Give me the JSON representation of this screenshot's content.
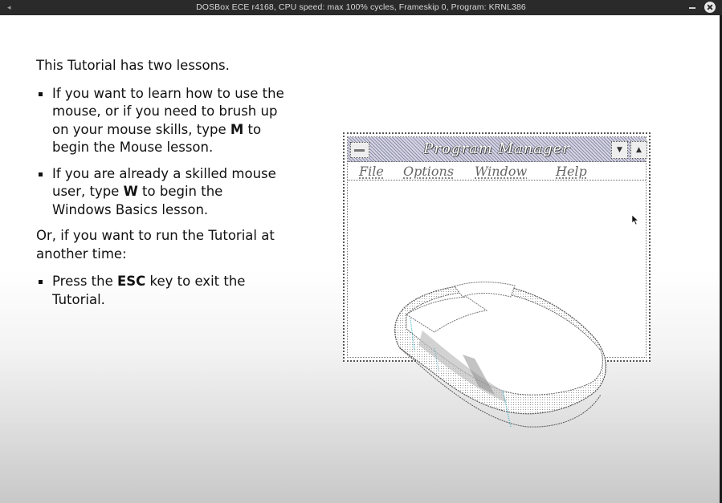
{
  "window": {
    "title": "DOSBox ECE r4168, CPU speed: max 100% cycles, Frameskip  0, Program:  KRNL386"
  },
  "tutorial": {
    "intro": "This Tutorial has two lessons.",
    "bullet1_a": "If you want to learn how to use the mouse, or if you need to brush up on your mouse skills, type ",
    "bullet1_key": "M",
    "bullet1_b": " to begin the Mouse lesson.",
    "bullet2_a": "If you are already a skilled mouse user, type ",
    "bullet2_key": "W",
    "bullet2_b": " to begin the Windows Basics lesson.",
    "or_text": "Or, if you want to run the Tutorial at another time:",
    "bullet3_a": "Press the ",
    "bullet3_key": "ESC",
    "bullet3_b": " key to exit the Tutorial."
  },
  "program_manager": {
    "title": "Program Manager",
    "menu": [
      "File",
      "Options",
      "Window",
      "Help"
    ]
  },
  "icons": [
    "window-menu-icon",
    "minimize-icon",
    "maximize-icon",
    "close-icon",
    "mouse-cursor-icon",
    "mouse-illustration"
  ],
  "colors": {
    "titlebar_bg": "#2a2a2a",
    "pm_title_pattern": "#8e8eaa",
    "mouse_highlight": "#38b6c8"
  }
}
